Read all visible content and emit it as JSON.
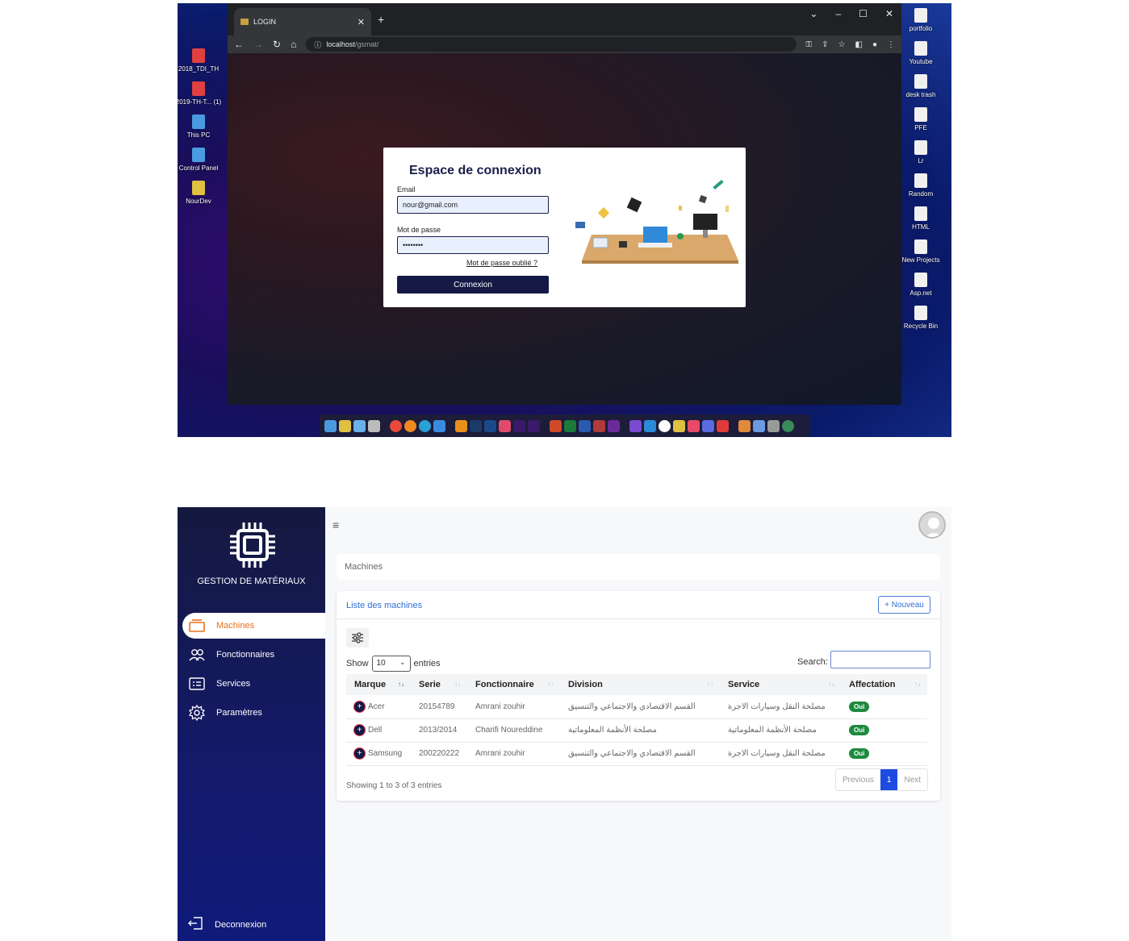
{
  "desktop": {
    "left_icons": [
      {
        "label": "2018_TDI_TH",
        "color": "#e04040"
      },
      {
        "label": "2019-TH-T... (1)",
        "color": "#e04040"
      },
      {
        "label": "This PC",
        "color": "#4a9ae0"
      },
      {
        "label": "Control Panel",
        "color": "#4a9ae0"
      },
      {
        "label": "NourDev",
        "color": "#e0c040"
      }
    ],
    "right_icons": [
      {
        "label": "portfolio"
      },
      {
        "label": "Youtube"
      },
      {
        "label": "desk trash"
      },
      {
        "label": "PFE"
      },
      {
        "label": "Lr"
      },
      {
        "label": "Random"
      },
      {
        "label": "HTML"
      },
      {
        "label": "New Projects"
      },
      {
        "label": "Asp.net"
      },
      {
        "label": "Recycle Bin"
      }
    ]
  },
  "browser": {
    "tab_title": "LOGIN",
    "url_host": "localhost",
    "url_path": "/gsmat/"
  },
  "login": {
    "title": "Espace de connexion",
    "email_label": "Email",
    "email_value": "nour@gmail.com",
    "password_label": "Mot de passe",
    "password_value": "••••••••",
    "forgot_label": "Mot de passe oublié ?",
    "submit_label": "Connexion"
  },
  "app": {
    "brand": "GESTION DE MATÉRIAUX",
    "nav": [
      {
        "label": "Machines",
        "icon": "machine-icon",
        "active": true
      },
      {
        "label": "Fonctionnaires",
        "icon": "users-icon",
        "active": false
      },
      {
        "label": "Services",
        "icon": "list-icon",
        "active": false
      },
      {
        "label": "Paramètres",
        "icon": "gear-icon",
        "active": false
      }
    ],
    "logout_label": "Deconnexion",
    "breadcrumb": "Machines",
    "card_title": "Liste des machines",
    "new_button": "+ Nouveau",
    "show_label": "Show",
    "show_value": "10",
    "entries_label": "entries",
    "search_label": "Search:",
    "columns": [
      "Marque",
      "Serie",
      "Fonctionnaire",
      "Division",
      "Service",
      "Affectation"
    ],
    "rows": [
      {
        "marque": "Acer",
        "serie": "20154789",
        "fonctionnaire": "Amrani zouhir",
        "division": "القسم الاقتصادي والاجتماعي والتنسيق",
        "service": "مصلحة النقل وسيارات الاجرة",
        "affectation": "Oui"
      },
      {
        "marque": "Dell",
        "serie": "2013/2014",
        "fonctionnaire": "Charifi Noureddine",
        "division": "مصلحة الأنظمة المعلوماتية",
        "service": "مصلحة الأنظمة المعلوماتية",
        "affectation": "Oui"
      },
      {
        "marque": "Samsung",
        "serie": "200220222",
        "fonctionnaire": "Amrani zouhir",
        "division": "القسم الاقتصادي والاجتماعي والتنسيق",
        "service": "مصلحة النقل وسيارات الاجرة",
        "affectation": "Oui"
      }
    ],
    "info": "Showing 1 to 3 of 3 entries",
    "pager": {
      "previous": "Previous",
      "current": "1",
      "next": "Next"
    },
    "accent": "#e8701a",
    "badge_color": "#1d8a3e"
  }
}
